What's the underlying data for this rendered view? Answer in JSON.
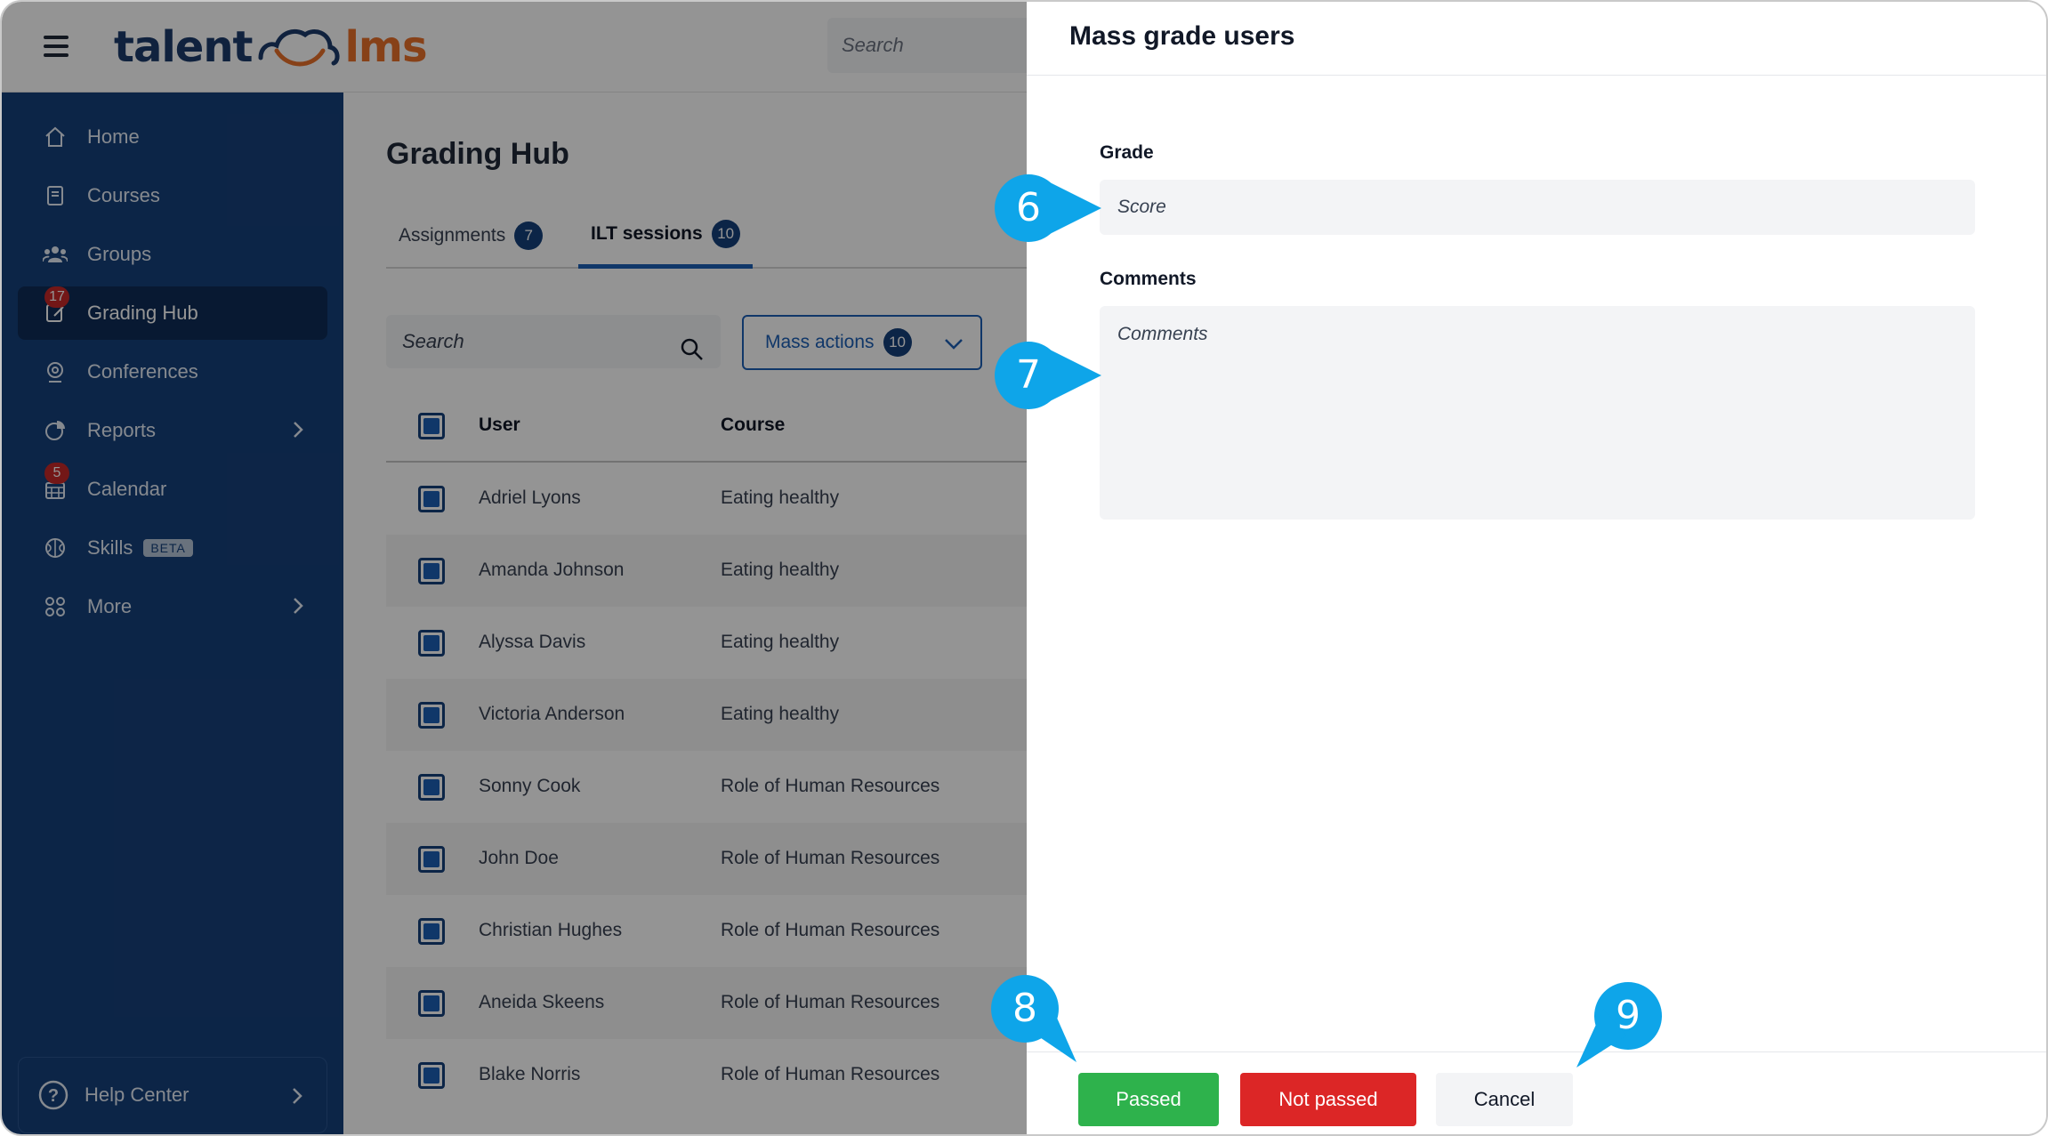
{
  "topbar": {
    "logo_left": "talent",
    "logo_right": "lms",
    "search_placeholder": "Search"
  },
  "sidebar": {
    "items": [
      {
        "label": "Home",
        "icon": "home-icon"
      },
      {
        "label": "Courses",
        "icon": "book-icon"
      },
      {
        "label": "Groups",
        "icon": "users-icon"
      },
      {
        "label": "Grading Hub",
        "icon": "grading-icon",
        "badge": "17",
        "active": true
      },
      {
        "label": "Conferences",
        "icon": "webcam-icon"
      },
      {
        "label": "Reports",
        "icon": "pie-chart-icon",
        "has_submenu": true
      },
      {
        "label": "Calendar",
        "icon": "calendar-icon",
        "badge": "5"
      },
      {
        "label": "Skills",
        "icon": "brain-icon",
        "tag": "BETA"
      },
      {
        "label": "More",
        "icon": "grid-icon",
        "has_submenu": true
      }
    ],
    "help": "Help Center"
  },
  "main": {
    "title": "Grading Hub",
    "tabs": [
      {
        "label": "Assignments",
        "count": "7"
      },
      {
        "label": "ILT sessions",
        "count": "10",
        "active": true
      }
    ],
    "search_placeholder": "Search",
    "mass_actions": {
      "label": "Mass actions",
      "count": "10"
    },
    "table": {
      "columns": [
        "User",
        "Course"
      ],
      "rows": [
        {
          "user": "Adriel Lyons",
          "course": "Eating healthy"
        },
        {
          "user": "Amanda Johnson",
          "course": "Eating healthy"
        },
        {
          "user": "Alyssa Davis",
          "course": "Eating healthy"
        },
        {
          "user": "Victoria Anderson",
          "course": "Eating healthy"
        },
        {
          "user": "Sonny Cook",
          "course": "Role of Human Resources"
        },
        {
          "user": "John Doe",
          "course": "Role of Human Resources"
        },
        {
          "user": "Christian Hughes",
          "course": "Role of Human Resources"
        },
        {
          "user": "Aneida Skeens",
          "course": "Role of Human Resources"
        },
        {
          "user": "Blake Norris",
          "course": "Role of Human Resources"
        }
      ]
    }
  },
  "drawer": {
    "title": "Mass grade users",
    "grade_label": "Grade",
    "grade_placeholder": "Score",
    "comments_label": "Comments",
    "comments_placeholder": "Comments",
    "buttons": {
      "passed": "Passed",
      "not_passed": "Not passed",
      "cancel": "Cancel"
    }
  },
  "callouts": [
    "6",
    "7",
    "8",
    "9"
  ],
  "colors": {
    "sidebar": "#16407a",
    "accent": "#1d5fb5",
    "callout": "#0ea5e9",
    "passed": "#2eb24c",
    "not_passed": "#dc2626",
    "badge": "#c62828"
  }
}
